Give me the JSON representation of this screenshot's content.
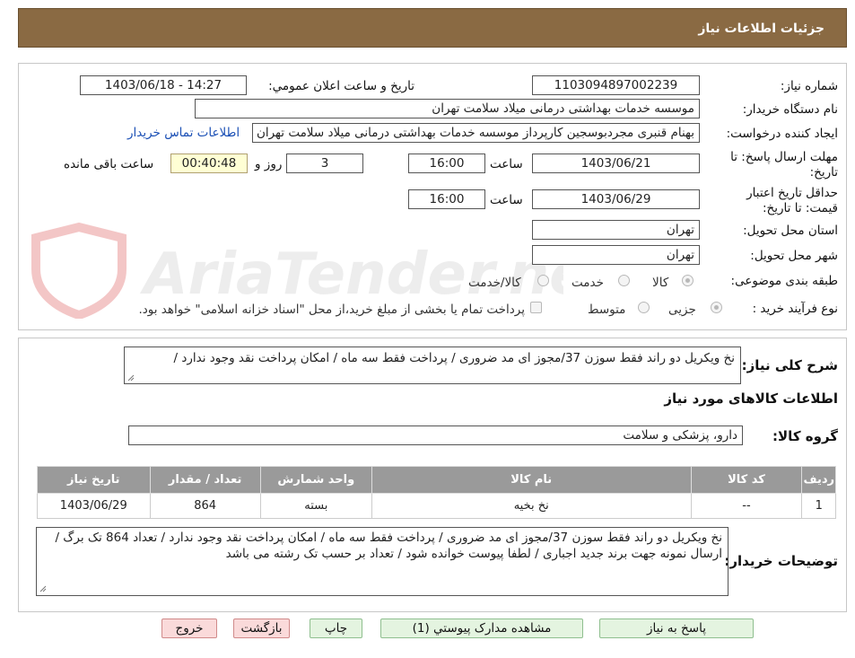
{
  "header": {
    "title": "جزئیات اطلاعات نیاز"
  },
  "form": {
    "need_number_label": "شماره نیاز:",
    "need_number": "1103094897002239",
    "announce_label": "تاریخ و ساعت اعلان عمومي:",
    "announce_value": "1403/06/18 - 14:27",
    "buyer_label": "نام دستگاه خریدار:",
    "buyer_value": "موسسه خدمات بهداشتی درمانی میلاد سلامت تهران",
    "creator_label": "ایجاد کننده درخواست:",
    "creator_value": "بهنام قنبری مجردبوسجین کارپرداز موسسه خدمات بهداشتی درمانی میلاد سلامت تهران",
    "contact_link": "اطلاعات تماس خریدار",
    "deadline_label_1": "مهلت ارسال پاسخ: تا",
    "deadline_label_2": "تاریخ:",
    "deadline_date": "1403/06/21",
    "time_label": "ساعت",
    "deadline_time": "16:00",
    "days_value": "3",
    "days_label": "روز و",
    "remaining_time": "00:40:48",
    "remaining_label": "ساعت باقی مانده",
    "validity_label_1": "حداقل تاریخ اعتبار",
    "validity_label_2": "قیمت: تا تاریخ:",
    "validity_date": "1403/06/29",
    "validity_time": "16:00",
    "province_label": "استان محل تحویل:",
    "province_value": "تهران",
    "city_label": "شهر محل تحویل:",
    "city_value": "تهران",
    "category_label": "طبقه بندی موضوعی:",
    "category_options": [
      "کالا",
      "خدمت",
      "کالا/خدمت"
    ],
    "process_label": "نوع فرآیند خرید :",
    "process_options": [
      "جزیی",
      "متوسط"
    ],
    "payment_note": "پرداخت تمام یا بخشی از مبلغ خرید،از محل \"اسناد خزانه اسلامی\" خواهد بود."
  },
  "summary": {
    "label": "شرح کلی نیاز:",
    "value": "نخ  ویکریل دو   راند فقط  سوزن 37/مجوز ای مد ضروری / پرداخت فقط سه ماه / امکان پرداخت نقد وجود ندارد /"
  },
  "goods": {
    "section_title": "اطلاعات کالاهای مورد نیاز",
    "group_label": "گروه کالا:",
    "group_value": "دارو، پزشکی و سلامت",
    "columns": [
      "ردیف",
      "کد کالا",
      "نام کالا",
      "واحد شمارش",
      "تعداد / مقدار",
      "تاریخ نیاز"
    ],
    "rows": [
      [
        "1",
        "--",
        "نخ بخیه",
        "بسته",
        "864",
        "1403/06/29"
      ]
    ]
  },
  "buyer_notes": {
    "label": "توضیحات خریدار:",
    "value": "نخ  ویکریل دو   راند فقط  سوزن 37/مجوز ای مد ضروری / پرداخت فقط سه ماه / امکان پرداخت نقد وجود ندارد / تعداد  864  تک برگ   / ارسال نمونه جهت برند جدید اجباری / لطفا پیوست خوانده شود / تعداد بر حسب  تک رشته می باشد"
  },
  "buttons": {
    "reply": "پاسخ به نیاز",
    "attachments": "مشاهده مدارک پیوستي (1)",
    "print": "چاپ",
    "back": "بازگشت",
    "exit": "خروج"
  },
  "watermark": {
    "text": "AriaTender.neT"
  }
}
